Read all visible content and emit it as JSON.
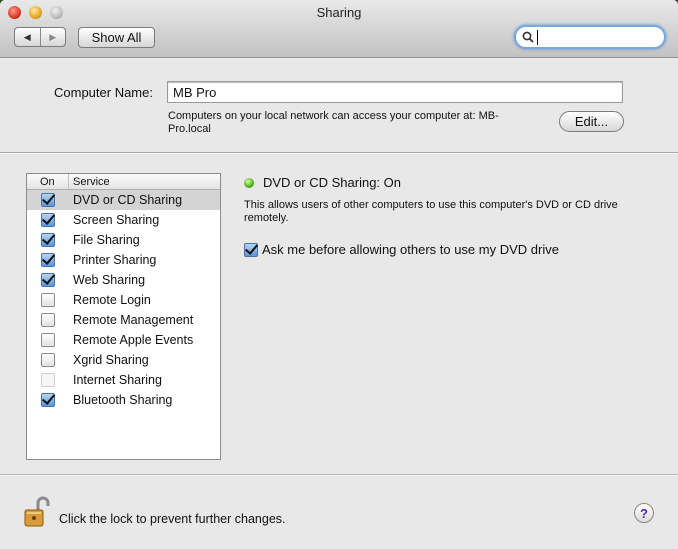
{
  "window": {
    "title": "Sharing"
  },
  "toolbar": {
    "back_icon": "back-arrow-icon",
    "forward_icon": "forward-arrow-icon",
    "show_all_label": "Show All",
    "search_value": "",
    "search_focus_color": "#7aa7e0"
  },
  "computer_name": {
    "label": "Computer Name:",
    "value": "MB Pro",
    "description": "Computers on your local network can access your computer at: MB-Pro.local",
    "edit_label": "Edit..."
  },
  "services": {
    "header_on": "On",
    "header_service": "Service",
    "items": [
      {
        "name": "DVD or CD Sharing",
        "checked": true,
        "selected": true,
        "enabled": true
      },
      {
        "name": "Screen Sharing",
        "checked": true,
        "selected": false,
        "enabled": true
      },
      {
        "name": "File Sharing",
        "checked": true,
        "selected": false,
        "enabled": true
      },
      {
        "name": "Printer Sharing",
        "checked": true,
        "selected": false,
        "enabled": true
      },
      {
        "name": "Web Sharing",
        "checked": true,
        "selected": false,
        "enabled": true
      },
      {
        "name": "Remote Login",
        "checked": false,
        "selected": false,
        "enabled": true
      },
      {
        "name": "Remote Management",
        "checked": false,
        "selected": false,
        "enabled": true
      },
      {
        "name": "Remote Apple Events",
        "checked": false,
        "selected": false,
        "enabled": true
      },
      {
        "name": "Xgrid Sharing",
        "checked": false,
        "selected": false,
        "enabled": true
      },
      {
        "name": "Internet Sharing",
        "checked": false,
        "selected": false,
        "enabled": false
      },
      {
        "name": "Bluetooth Sharing",
        "checked": true,
        "selected": false,
        "enabled": true
      }
    ]
  },
  "detail": {
    "status_color": "#4fae1b",
    "status_text": "DVD or CD Sharing: On",
    "description": "This allows users of other computers to use this computer's DVD or CD drive remotely.",
    "ask_label": "Ask me before allowing others to use my DVD drive",
    "ask_checked": true
  },
  "footer": {
    "lock_icon": "unlocked-padlock-icon",
    "lock_text": "Click the lock to prevent further changes.",
    "help_label": "?"
  }
}
